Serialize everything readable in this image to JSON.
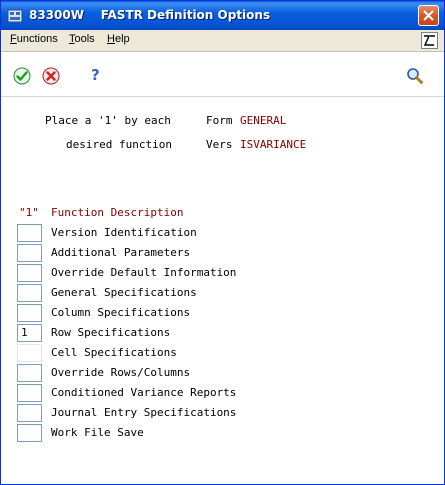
{
  "window": {
    "program_id": "83300W",
    "title": "FASTR Definition Options"
  },
  "menu": [
    {
      "label": "Functions",
      "accel": "F",
      "rest": "unctions"
    },
    {
      "label": "Tools",
      "accel": "T",
      "rest": "ools"
    },
    {
      "label": "Help",
      "accel": "H",
      "rest": "elp"
    }
  ],
  "toolbar": {
    "ok_icon": "check-icon",
    "cancel_icon": "cancel-icon",
    "help_icon": "question-icon",
    "search_icon": "search-icon",
    "help_glyph": "?"
  },
  "instructions": {
    "line1": "Place a '1' by each",
    "line2": "desired function",
    "form_label": "Form",
    "form_value": "GENERAL",
    "vers_label": "Vers",
    "vers_value": "ISVARIANCE"
  },
  "list_header": {
    "quote_one": "\"1\"",
    "description": "Function Description"
  },
  "functions": [
    {
      "value": "",
      "label": "Version Identification"
    },
    {
      "value": "",
      "label": "Additional Parameters"
    },
    {
      "value": "",
      "label": "Override Default Information"
    },
    {
      "value": "",
      "label": "General Specifications"
    },
    {
      "value": "",
      "label": "Column Specifications"
    },
    {
      "value": "1",
      "label": "Row Specifications"
    },
    {
      "value": "",
      "label": "Cell Specifications"
    },
    {
      "value": "",
      "label": "Override Rows/Columns"
    },
    {
      "value": "",
      "label": "Conditioned Variance Reports"
    },
    {
      "value": "",
      "label": "Journal Entry Specifications"
    },
    {
      "value": "",
      "label": "Work File Save"
    }
  ],
  "colors": {
    "title_bar": "#0a5fdc",
    "value_text": "#800000",
    "ok_green": "#1f9a1f",
    "cancel_red": "#d42020"
  }
}
